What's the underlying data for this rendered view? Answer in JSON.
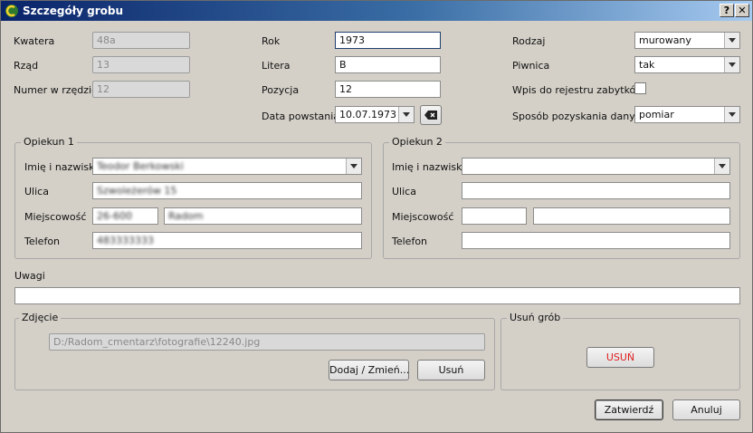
{
  "window": {
    "title": "Szczegóły grobu",
    "help_btn": "?",
    "close_btn": "✕"
  },
  "location": {
    "kwatera_label": "Kwatera",
    "kwatera_value": "48a",
    "rzad_label": "Rząd",
    "rzad_value": "13",
    "numer_label": "Numer w rzędzie",
    "numer_value": "12"
  },
  "middle": {
    "rok_label": "Rok",
    "rok_value": "1973",
    "litera_label": "Litera",
    "litera_value": "B",
    "pozycja_label": "Pozycja",
    "pozycja_value": "12",
    "data_label": "Data powstania",
    "data_value": "10.07.1973"
  },
  "right": {
    "rodzaj_label": "Rodzaj",
    "rodzaj_value": "murowany",
    "piwnica_label": "Piwnica",
    "piwnica_value": "tak",
    "wpis_label": "Wpis do rejestru zabytków",
    "wpis_checked": false,
    "sposob_label": "Sposób pozyskania danych",
    "sposob_value": "pomiar"
  },
  "opiekun1": {
    "title": "Opiekun 1",
    "imie_label": "Imię i nazwisko",
    "imie_value": "Teodor Berkowski",
    "ulica_label": "Ulica",
    "ulica_value": "Szwoleżerów 15",
    "miejscowosc_label": "Miejscowość",
    "kod_value": "26-600",
    "miasto_value": "Radom",
    "telefon_label": "Telefon",
    "telefon_value": "483333333"
  },
  "opiekun2": {
    "title": "Opiekun 2",
    "imie_label": "Imię i nazwisko",
    "imie_value": "",
    "ulica_label": "Ulica",
    "ulica_value": "",
    "miejscowosc_label": "Miejscowość",
    "kod_value": "",
    "miasto_value": "",
    "telefon_label": "Telefon",
    "telefon_value": ""
  },
  "uwagi": {
    "label": "Uwagi",
    "value": ""
  },
  "zdjecie": {
    "title": "Zdjęcie",
    "path": "D:/Radom_cmentarz\\fotografie\\12240.jpg",
    "add_button": "Dodaj / Zmień...",
    "remove_button": "Usuń"
  },
  "usun_grob": {
    "title": "Usuń grób",
    "button": "USUŃ",
    "button_color": "#e02020"
  },
  "footer": {
    "ok_button": "Zatwierdź",
    "cancel_button": "Anuluj"
  }
}
